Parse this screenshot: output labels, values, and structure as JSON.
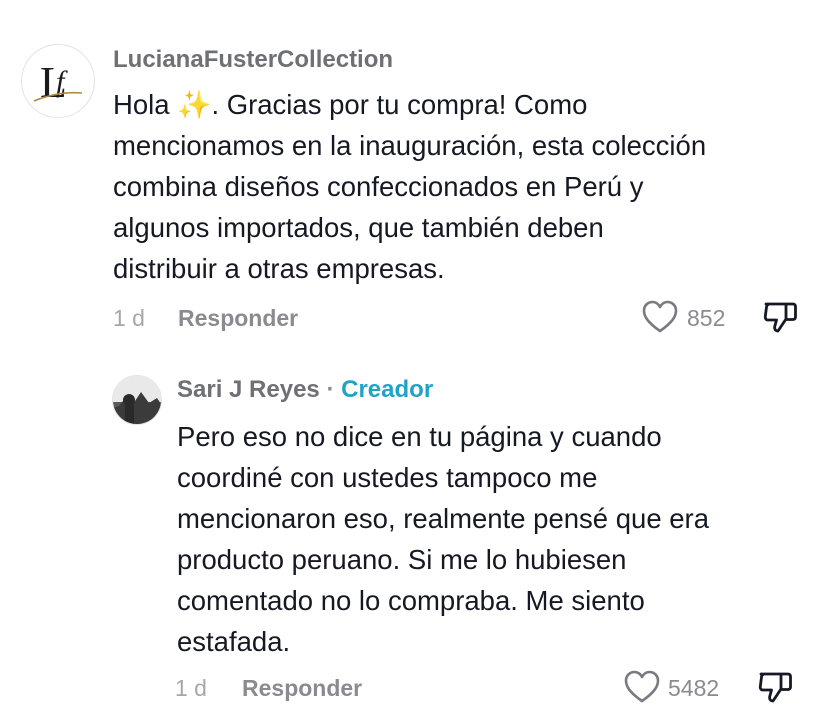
{
  "comments": [
    {
      "username": "LucianaFusterCollection",
      "avatar_icon": "brand-logo-icon",
      "text_lines": [
        "Hola ✨. Gracias por tu compra! Como",
        "mencionamos en la inauguración, esta colección",
        "combina diseños confeccionados en Perú y",
        "algunos importados, que también deben",
        "distribuir a otras empresas."
      ],
      "age": "1 d",
      "reply_label": "Responder",
      "likes": "852"
    },
    {
      "username": "Sari J Reyes",
      "separator": "·",
      "badge": "Creador",
      "avatar_icon": "user-photo-avatar",
      "text_lines": [
        "Pero eso no dice en tu página y cuando",
        "coordiné con ustedes tampoco me",
        "mencionaron eso, realmente pensé que era",
        "producto peruano. Si me lo hubiesen",
        "comentado no lo compraba. Me siento",
        "estafada."
      ],
      "age": "1 d",
      "reply_label": "Responder",
      "likes": "5482"
    }
  ],
  "colors": {
    "creator_badge": "#21a3c8",
    "text": "#161823",
    "muted": "#8a8b91"
  }
}
